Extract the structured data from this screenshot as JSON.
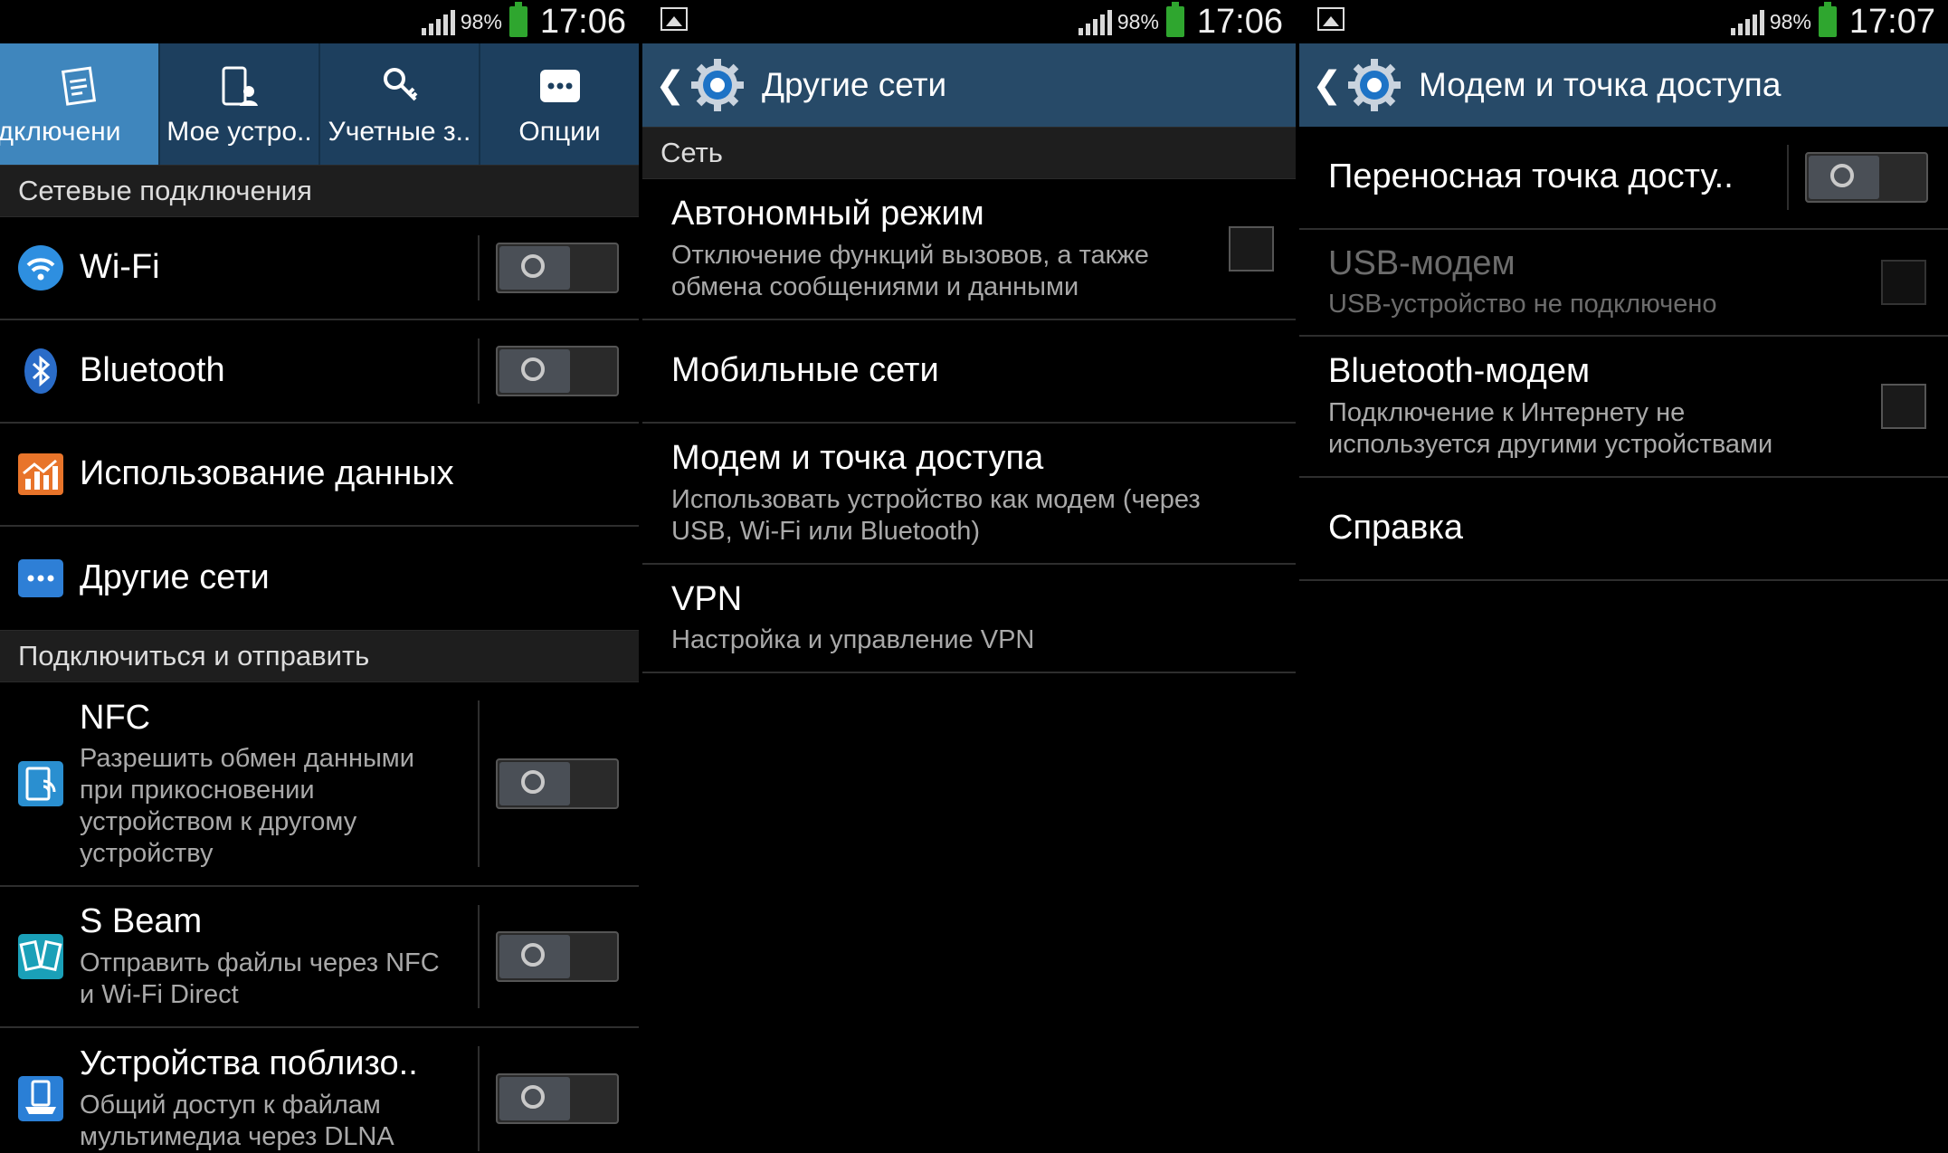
{
  "statusbar": {
    "s1": {
      "battery": "98%",
      "time": "17:06"
    },
    "s2": {
      "battery": "98%",
      "time": "17:06"
    },
    "s3": {
      "battery": "98%",
      "time": "17:07"
    }
  },
  "screen1": {
    "tabs": [
      {
        "label": "одключени",
        "icon": "connections-icon",
        "active": true
      },
      {
        "label": "Мое устро..",
        "icon": "my-device-icon",
        "active": false
      },
      {
        "label": "Учетные з..",
        "icon": "key-icon",
        "active": false
      },
      {
        "label": "Опции",
        "icon": "more-icon",
        "active": false
      }
    ],
    "section1": "Сетевые подключения",
    "items1": [
      {
        "title": "Wi-Fi",
        "icon": "wifi-icon",
        "toggle": "off"
      },
      {
        "title": "Bluetooth",
        "icon": "bluetooth-icon",
        "toggle": "off"
      },
      {
        "title": "Использование данных",
        "icon": "data-usage-icon"
      },
      {
        "title": "Другие сети",
        "icon": "more-networks-icon"
      }
    ],
    "section2": "Подключиться и отправить",
    "items2": [
      {
        "title": "NFC",
        "sub1": "Разрешить обмен данными",
        "sub2": "при прикосновении",
        "sub3": "устройством к другому",
        "sub4": "устройству",
        "icon": "nfc-icon",
        "toggle": "off"
      },
      {
        "title": "S Beam",
        "sub1": "Отправить файлы через NFC",
        "sub2": "и Wi-Fi Direct",
        "icon": "sbeam-icon",
        "toggle": "off"
      },
      {
        "title": "Устройства поблизо..",
        "sub1": "Общий доступ к файлам",
        "sub2": "мультимедиа через DLNA",
        "icon": "nearby-devices-icon",
        "toggle": "off"
      }
    ]
  },
  "screen2": {
    "title": "Другие сети",
    "section": "Сеть",
    "items": [
      {
        "title": "Автономный режим",
        "sub1": "Отключение функций вызовов, а также",
        "sub2": "обмена сообщениями и данными",
        "checkbox": "unchecked"
      },
      {
        "title": "Мобильные сети"
      },
      {
        "title": "Модем и точка доступа",
        "sub1": "Использовать устройство как модем (через",
        "sub2": "USB, Wi-Fi или Bluetooth)"
      },
      {
        "title": "VPN",
        "sub1": "Настройка и управление VPN"
      }
    ]
  },
  "screen3": {
    "title": "Модем и точка доступа",
    "items": [
      {
        "title": "Переносная точка досту..",
        "toggle": "off"
      },
      {
        "title": "USB-модем",
        "sub1": "USB-устройство не подключено",
        "checkbox": "disabled"
      },
      {
        "title": "Bluetooth-модем",
        "sub1": "Подключение к Интернету не",
        "sub2": "используется другими устройствами",
        "checkbox": "unchecked"
      },
      {
        "title": "Справка"
      }
    ]
  },
  "colors": {
    "tab_bar": "#1d3f5e",
    "tab_active": "#3f86bd",
    "action_bar": "#274a68",
    "section_bg": "#1e1e1e",
    "divider": "#2e2e2e",
    "battery": "#2fa62f"
  }
}
